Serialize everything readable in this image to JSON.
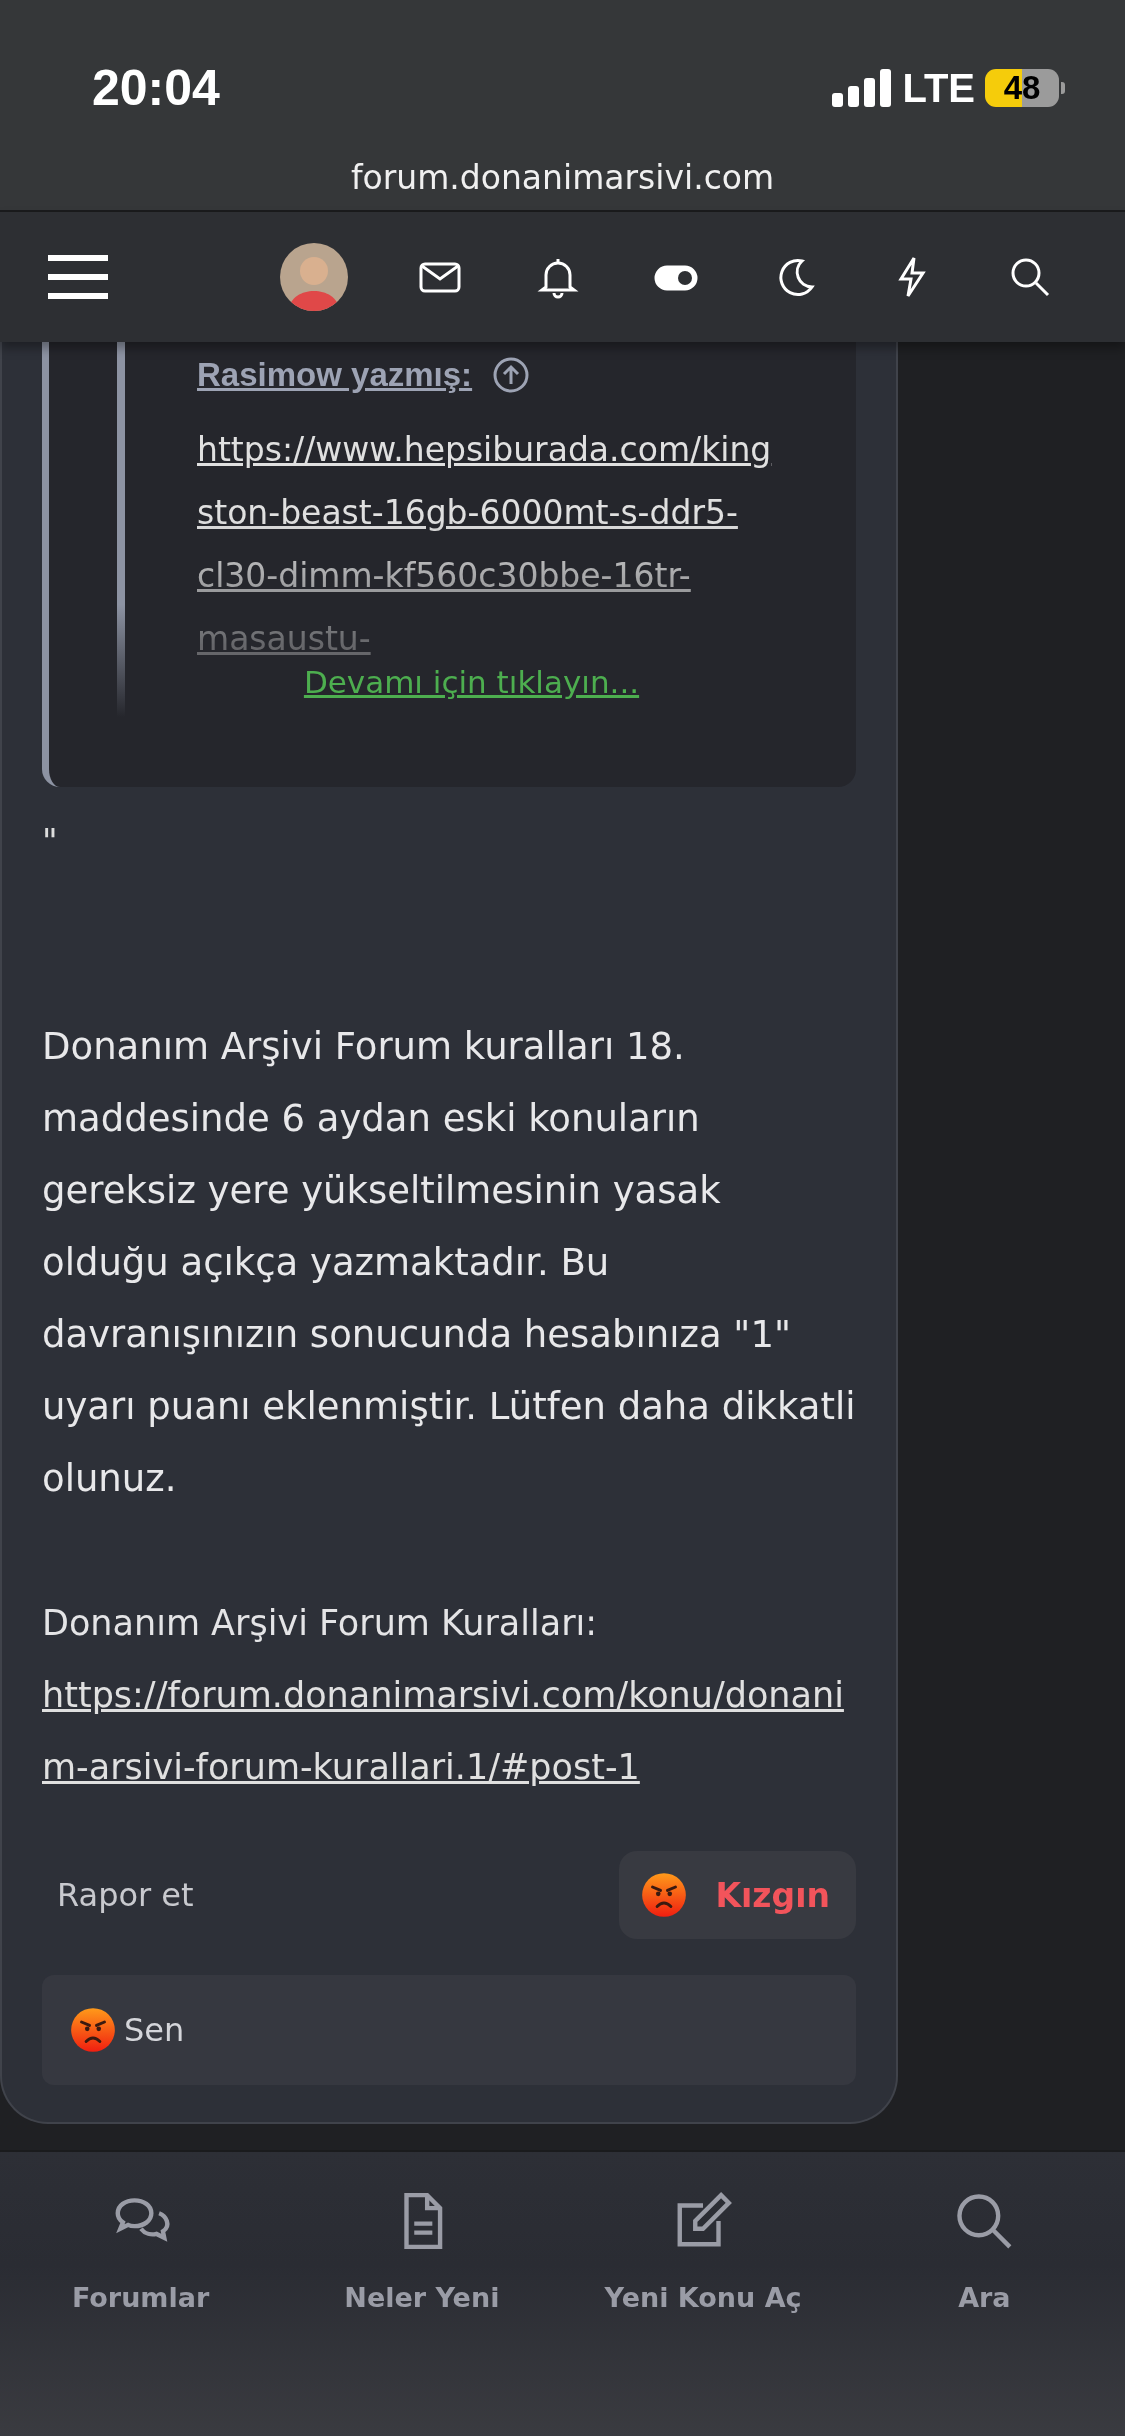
{
  "status_bar": {
    "time": "20:04",
    "network": "LTE",
    "battery": "48"
  },
  "browser": {
    "url": "forum.donanimarsivi.com"
  },
  "quote": {
    "author": "Rasimow yazmış:",
    "text": "https://www.hepsiburada.com/kingston-beast-16gb-6000mt-s-ddr5-cl30-dimm-kf560c30bbe-16tr-masaustu-",
    "expand_link": "Devamı için tıklayın..."
  },
  "post": {
    "stray_mark": "\"",
    "paragraph": "Donanım Arşivi Forum kuralları 18. maddesinde 6 aydan eski konuların gereksiz yere yükseltilmesinin yasak olduğu açıkça yazmaktadır. Bu davranışınızın sonucunda hesabınıza \"1\" uyarı puanı eklenmiştir. Lütfen daha dikkatli olunuz.",
    "rules_label": "Donanım Arşivi Forum Kuralları:",
    "rules_link": "https://forum.donanimarsivi.com/konu/donanim-arsivi-forum-kurallari.1/#post-1"
  },
  "actions": {
    "report": "Rapor et",
    "reaction": "Kızgın"
  },
  "reaction_summary": {
    "users": "Sen"
  },
  "tab_bar": [
    {
      "label": "Forumlar",
      "kind": "forums"
    },
    {
      "label": "Neler Yeni",
      "kind": "new"
    },
    {
      "label": "Yeni Konu Aç",
      "kind": "compose"
    },
    {
      "label": "Ara",
      "kind": "search"
    }
  ]
}
